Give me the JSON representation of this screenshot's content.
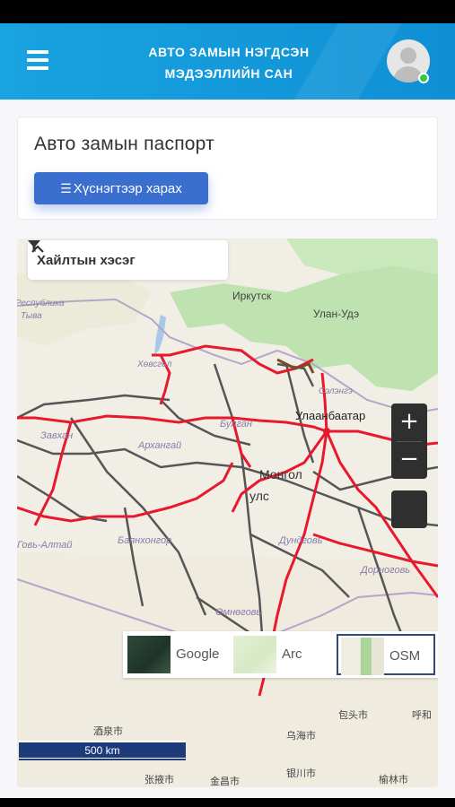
{
  "header": {
    "title_line1": "АВТО ЗАМЫН НЭГДСЭН",
    "title_line2": "МЭДЭЭЛЛИЙН САН"
  },
  "passport": {
    "title": "Авто замын паспорт",
    "list_button": "Хүснэгтээр харах"
  },
  "map": {
    "search_label": "Хайлтын хэсэг",
    "zoom_in": "+",
    "zoom_out": "−",
    "scale_label": "500 km",
    "basemaps": [
      "Google",
      "Arc",
      "OSM"
    ],
    "selected_basemap": "OSM",
    "places": [
      "Иркутск",
      "Улан-Удэ",
      "Улаанбаатар",
      "Монгол",
      "улс",
      "Сэлэнгэ",
      "Хөвсгөл",
      "Завхан",
      "Архангай",
      "Булган",
      "Баянхонгор",
      "Говь-Алтай",
      "Дундговь",
      "Дорноговь",
      "Өмнөговь",
      "Тыва",
      "Республика",
      "包头市",
      "呼和",
      "乌海市",
      "酒泉市",
      "银川市",
      "张掖市",
      "金昌市",
      "榆林市"
    ],
    "colors": {
      "road_primary": "#e8192c",
      "road_secondary": "#555555",
      "accent": "#3b6fcf",
      "header": "#129ad8"
    }
  }
}
